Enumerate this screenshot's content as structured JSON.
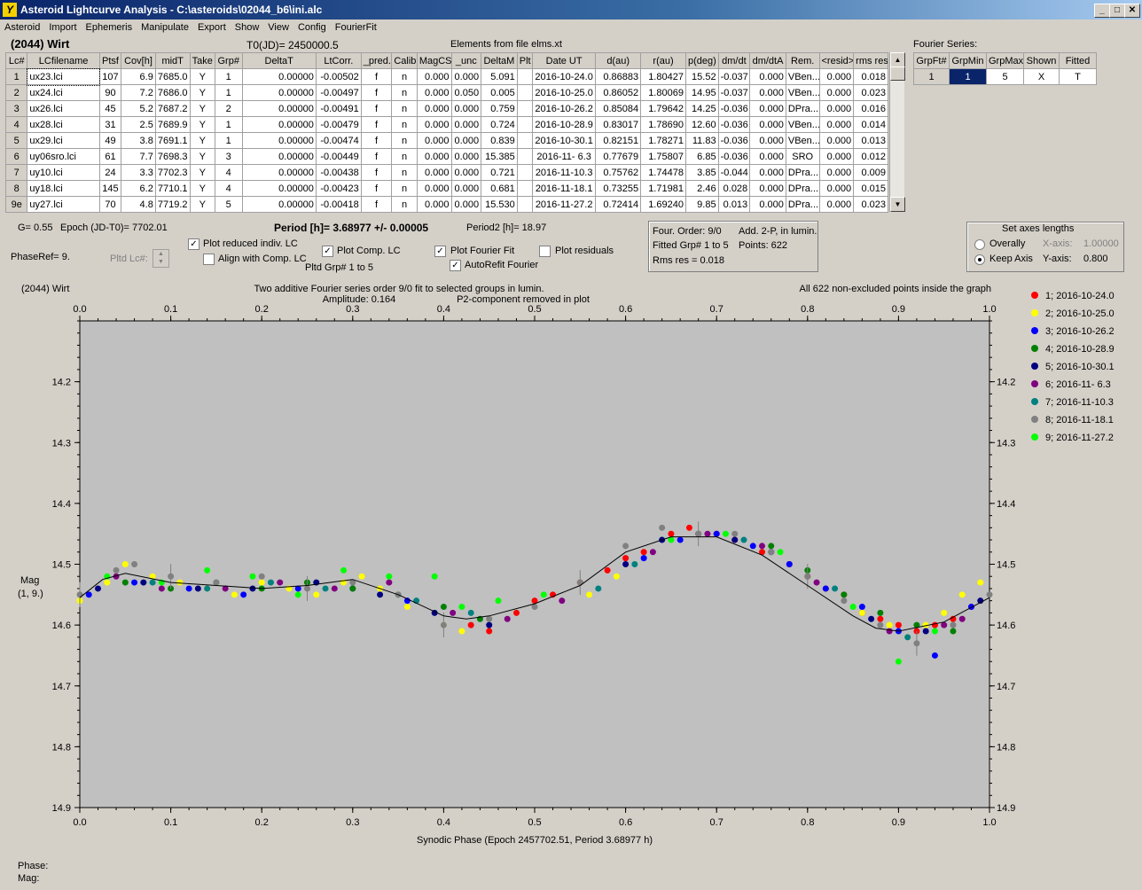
{
  "window": {
    "title": "Asteroid Lightcurve Analysis - C:\\asteroids\\02044_b6\\ini.alc",
    "min": "_",
    "max": "□",
    "close": "✕",
    "icon": "Y"
  },
  "menu": [
    "Asteroid",
    "Import",
    "Ephemeris",
    "Manipulate",
    "Export",
    "Show",
    "View",
    "Config",
    "FourierFit"
  ],
  "header": {
    "object": "(2044) Wirt",
    "t0": "T0(JD)= 2450000.5",
    "elements": "Elements from file elms.xt"
  },
  "lc_table": {
    "columns": [
      "Lc#",
      "LCfilename",
      "Ptsf",
      "Cov[h]",
      "midT",
      "Take",
      "Grp#",
      "DeltaT",
      "LtCorr.",
      "_pred.",
      "Calib.",
      "MagCS",
      "_unc",
      "DeltaM",
      "Plt",
      "Date UT",
      "d(au)",
      "r(au)",
      "p(deg)",
      "dm/dt",
      "dm/dtA",
      "Rem.",
      "<resid>",
      "rms res"
    ],
    "rows": [
      [
        "1",
        "ux23.lci",
        "107",
        "6.9",
        "7685.0",
        "Y",
        "1",
        "0.00000",
        "-0.00502",
        "f",
        "n",
        "0.000",
        "0.000",
        "5.091",
        "",
        "2016-10-24.0",
        "0.86883",
        "1.80427",
        "15.52",
        "-0.037",
        "0.000",
        "VBen...",
        "0.000",
        "0.018"
      ],
      [
        "2",
        "ux24.lci",
        "90",
        "7.2",
        "7686.0",
        "Y",
        "1",
        "0.00000",
        "-0.00497",
        "f",
        "n",
        "0.000",
        "0.050",
        "0.005",
        "",
        "2016-10-25.0",
        "0.86052",
        "1.80069",
        "14.95",
        "-0.037",
        "0.000",
        "VBen...",
        "0.000",
        "0.023"
      ],
      [
        "3",
        "ux26.lci",
        "45",
        "5.2",
        "7687.2",
        "Y",
        "2",
        "0.00000",
        "-0.00491",
        "f",
        "n",
        "0.000",
        "0.000",
        "0.759",
        "",
        "2016-10-26.2",
        "0.85084",
        "1.79642",
        "14.25",
        "-0.036",
        "0.000",
        "DPra...",
        "0.000",
        "0.016"
      ],
      [
        "4",
        "ux28.lci",
        "31",
        "2.5",
        "7689.9",
        "Y",
        "1",
        "0.00000",
        "-0.00479",
        "f",
        "n",
        "0.000",
        "0.000",
        "0.724",
        "",
        "2016-10-28.9",
        "0.83017",
        "1.78690",
        "12.60",
        "-0.036",
        "0.000",
        "VBen...",
        "0.000",
        "0.014"
      ],
      [
        "5",
        "ux29.lci",
        "49",
        "3.8",
        "7691.1",
        "Y",
        "1",
        "0.00000",
        "-0.00474",
        "f",
        "n",
        "0.000",
        "0.000",
        "0.839",
        "",
        "2016-10-30.1",
        "0.82151",
        "1.78271",
        "11.83",
        "-0.036",
        "0.000",
        "VBen...",
        "0.000",
        "0.013"
      ],
      [
        "6",
        "uy06sro.lci",
        "61",
        "7.7",
        "7698.3",
        "Y",
        "3",
        "0.00000",
        "-0.00449",
        "f",
        "n",
        "0.000",
        "0.000",
        "15.385",
        "",
        "2016-11- 6.3",
        "0.77679",
        "1.75807",
        "6.85",
        "-0.036",
        "0.000",
        "SRO",
        "0.000",
        "0.012"
      ],
      [
        "7",
        "uy10.lci",
        "24",
        "3.3",
        "7702.3",
        "Y",
        "4",
        "0.00000",
        "-0.00438",
        "f",
        "n",
        "0.000",
        "0.000",
        "0.721",
        "",
        "2016-11-10.3",
        "0.75762",
        "1.74478",
        "3.85",
        "-0.044",
        "0.000",
        "DPra...",
        "0.000",
        "0.009"
      ],
      [
        "8",
        "uy18.lci",
        "145",
        "6.2",
        "7710.1",
        "Y",
        "4",
        "0.00000",
        "-0.00423",
        "f",
        "n",
        "0.000",
        "0.000",
        "0.681",
        "",
        "2016-11-18.1",
        "0.73255",
        "1.71981",
        "2.46",
        "0.028",
        "0.000",
        "DPra...",
        "0.000",
        "0.015"
      ],
      [
        "9e",
        "uy27.lci",
        "70",
        "4.8",
        "7719.2",
        "Y",
        "5",
        "0.00000",
        "-0.00418",
        "f",
        "n",
        "0.000",
        "0.000",
        "15.530",
        "",
        "2016-11-27.2",
        "0.72414",
        "1.69240",
        "9.85",
        "0.013",
        "0.000",
        "DPra...",
        "0.000",
        "0.023"
      ]
    ]
  },
  "fourier_series": {
    "title": "Fourier Series:",
    "columns": [
      "GrpFt#",
      "GrpMin",
      "GrpMax",
      "Shown",
      "Fitted"
    ],
    "row": [
      "1",
      "1",
      "5",
      "X",
      "T"
    ]
  },
  "controls": {
    "g": "G= 0.55",
    "epoch": "Epoch (JD-T0)= 7702.01",
    "period": "Period [h]= 3.68977 +/- 0.00005",
    "period2": "Period2 [h]= 18.97",
    "phaseref": "PhaseRef= 9.",
    "pltd_lc": "Pltd Lc#:",
    "cb_plot_reduced": "Plot reduced indiv. LC",
    "cb_align": "Align with Comp. LC",
    "cb_plot_comp": "Plot Comp. LC",
    "pltd_grp": "Pltd Grp#  1   to   5",
    "cb_plot_fourier": "Plot Fourier Fit",
    "cb_autorefit": "AutoRefit Fourier",
    "cb_plot_resid": "Plot residuals",
    "four_order": "Four. Order:  9/0",
    "add2p": "Add. 2-P, in lumin.",
    "fitted_grp": "Fitted Grp# 1 to 5",
    "points": "Points: 622",
    "rms": "Rms res     = 0.018",
    "axes_title": "Set axes lengths",
    "overall": "Overally",
    "keep_axis": "Keep Axis",
    "xaxis": "X-axis:",
    "xaxis_val": "1.00000",
    "yaxis": "Y-axis:",
    "yaxis_val": "0.800",
    "check_mark": "✓"
  },
  "chart_data": {
    "type": "scatter",
    "title": "Two additive Fourier series order 9/0 fit to selected groups in lumin.",
    "subtitle_left": "Amplitude: 0.164",
    "subtitle_right": "P2-component removed in plot",
    "top_left": "(2044) Wirt",
    "top_right": "All 622 non-excluded points inside the graph",
    "xlabel": "Synodic Phase (Epoch 2457702.51, Period 3.68977 h)",
    "ylabel": "Mag",
    "ylabel2": "(1, 9.)",
    "xlim": [
      0,
      1
    ],
    "ylim": [
      14.9,
      14.1
    ],
    "xticks": [
      "0.0",
      "0.1",
      "0.2",
      "0.3",
      "0.4",
      "0.5",
      "0.6",
      "0.7",
      "0.8",
      "0.9",
      "1.0"
    ],
    "yticks": [
      "14.2",
      "14.3",
      "14.4",
      "14.5",
      "14.6",
      "14.7",
      "14.8",
      "14.9"
    ],
    "fit_curve": {
      "x": [
        0,
        0.025,
        0.05,
        0.1,
        0.15,
        0.2,
        0.25,
        0.3,
        0.35,
        0.4,
        0.425,
        0.45,
        0.5,
        0.55,
        0.6,
        0.65,
        0.7,
        0.75,
        0.8,
        0.85,
        0.875,
        0.9,
        0.95,
        1.0
      ],
      "y": [
        14.555,
        14.525,
        14.515,
        14.53,
        14.535,
        14.54,
        14.535,
        14.525,
        14.55,
        14.585,
        14.59,
        14.585,
        14.565,
        14.535,
        14.48,
        14.455,
        14.455,
        14.485,
        14.535,
        14.585,
        14.605,
        14.61,
        14.595,
        14.555
      ]
    },
    "series": [
      {
        "name": "1; 2016-10-24.0",
        "color": "#ff0000",
        "x": [
          0.43,
          0.45,
          0.48,
          0.5,
          0.52,
          0.55,
          0.58,
          0.6,
          0.62,
          0.65,
          0.67,
          0.7,
          0.72,
          0.75,
          0.78,
          0.8,
          0.82,
          0.84,
          0.86,
          0.88,
          0.9,
          0.92,
          0.94,
          0.96,
          0.98
        ],
        "y": [
          14.6,
          14.61,
          14.58,
          14.56,
          14.55,
          14.53,
          14.51,
          14.49,
          14.48,
          14.45,
          14.44,
          14.45,
          14.46,
          14.48,
          14.5,
          14.52,
          14.54,
          14.55,
          14.58,
          14.59,
          14.6,
          14.61,
          14.6,
          14.59,
          14.57
        ]
      },
      {
        "name": "2; 2016-10-25.0",
        "color": "#ffff00",
        "x": [
          0.0,
          0.03,
          0.05,
          0.08,
          0.11,
          0.14,
          0.17,
          0.2,
          0.23,
          0.26,
          0.29,
          0.31,
          0.33,
          0.36,
          0.4,
          0.42,
          0.56,
          0.59,
          0.86,
          0.89,
          0.91,
          0.93,
          0.95,
          0.97,
          0.99
        ],
        "y": [
          14.56,
          14.53,
          14.5,
          14.52,
          14.53,
          14.54,
          14.55,
          14.53,
          14.54,
          14.55,
          14.53,
          14.52,
          14.54,
          14.57,
          14.6,
          14.61,
          14.55,
          14.52,
          14.58,
          14.6,
          14.62,
          14.6,
          14.58,
          14.55,
          14.53
        ]
      },
      {
        "name": "3; 2016-10-26.2",
        "color": "#0000ff",
        "x": [
          0.01,
          0.06,
          0.12,
          0.18,
          0.24,
          0.3,
          0.36,
          0.62,
          0.66,
          0.7,
          0.74,
          0.78,
          0.82,
          0.86,
          0.9,
          0.94,
          0.98
        ],
        "y": [
          14.55,
          14.53,
          14.54,
          14.55,
          14.54,
          14.54,
          14.56,
          14.49,
          14.46,
          14.45,
          14.47,
          14.5,
          14.54,
          14.57,
          14.61,
          14.65,
          14.57
        ]
      },
      {
        "name": "4; 2016-10-28.9",
        "color": "#008000",
        "x": [
          0.05,
          0.1,
          0.15,
          0.2,
          0.25,
          0.3,
          0.35,
          0.4,
          0.44,
          0.76,
          0.8,
          0.84,
          0.88,
          0.92,
          0.96
        ],
        "y": [
          14.53,
          14.54,
          14.53,
          14.54,
          14.53,
          14.54,
          14.55,
          14.57,
          14.59,
          14.47,
          14.51,
          14.55,
          14.58,
          14.6,
          14.61
        ]
      },
      {
        "name": "5; 2016-10-30.1",
        "color": "#000080",
        "x": [
          0.02,
          0.07,
          0.13,
          0.19,
          0.26,
          0.33,
          0.39,
          0.45,
          0.6,
          0.64,
          0.68,
          0.72,
          0.76,
          0.87,
          0.93,
          0.99
        ],
        "y": [
          14.54,
          14.53,
          14.54,
          14.54,
          14.53,
          14.55,
          14.58,
          14.6,
          14.5,
          14.46,
          14.45,
          14.46,
          14.48,
          14.59,
          14.61,
          14.56
        ]
      },
      {
        "name": "6; 2016-11- 6.3",
        "color": "#800080",
        "x": [
          0.04,
          0.09,
          0.16,
          0.22,
          0.28,
          0.34,
          0.41,
          0.47,
          0.53,
          0.63,
          0.69,
          0.75,
          0.81,
          0.89,
          0.95,
          0.97
        ],
        "y": [
          14.52,
          14.54,
          14.54,
          14.53,
          14.54,
          14.53,
          14.58,
          14.59,
          14.56,
          14.48,
          14.45,
          14.47,
          14.53,
          14.61,
          14.6,
          14.59
        ]
      },
      {
        "name": "7; 2016-11-10.3",
        "color": "#008080",
        "x": [
          0.08,
          0.14,
          0.21,
          0.27,
          0.37,
          0.43,
          0.57,
          0.61,
          0.73,
          0.83,
          0.91
        ],
        "y": [
          14.53,
          14.54,
          14.53,
          14.54,
          14.56,
          14.58,
          14.54,
          14.5,
          14.46,
          14.54,
          14.62
        ]
      },
      {
        "name": "8; 2016-11-18.1",
        "color": "#808080",
        "x": [
          0.0,
          0.04,
          0.06,
          0.1,
          0.15,
          0.2,
          0.25,
          0.3,
          0.35,
          0.4,
          0.45,
          0.5,
          0.55,
          0.6,
          0.64,
          0.68,
          0.72,
          0.76,
          0.8,
          0.84,
          0.88,
          0.92,
          0.96,
          1.0
        ],
        "y": [
          14.55,
          14.51,
          14.5,
          14.52,
          14.53,
          14.52,
          14.54,
          14.53,
          14.55,
          14.6,
          14.59,
          14.57,
          14.53,
          14.47,
          14.44,
          14.45,
          14.45,
          14.48,
          14.52,
          14.56,
          14.6,
          14.63,
          14.6,
          14.55
        ]
      },
      {
        "name": "9; 2016-11-27.2",
        "color": "#00ff00",
        "x": [
          0.03,
          0.09,
          0.14,
          0.19,
          0.24,
          0.29,
          0.34,
          0.39,
          0.42,
          0.46,
          0.51,
          0.65,
          0.71,
          0.77,
          0.85,
          0.9,
          0.94
        ],
        "y": [
          14.52,
          14.53,
          14.51,
          14.52,
          14.55,
          14.51,
          14.52,
          14.52,
          14.57,
          14.56,
          14.55,
          14.46,
          14.45,
          14.48,
          14.57,
          14.66,
          14.61
        ]
      }
    ]
  },
  "status": {
    "phase": "Phase:",
    "mag": "Mag:"
  }
}
